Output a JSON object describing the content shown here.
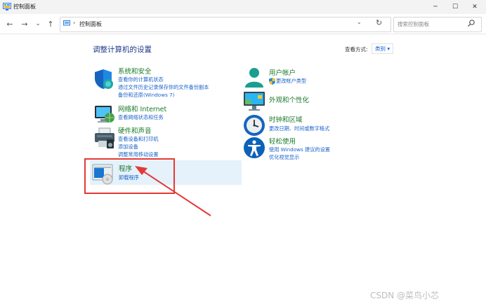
{
  "window": {
    "title": "控制面板"
  },
  "titlebar_buttons": {
    "minimize": "─",
    "maximize": "☐",
    "close": "✕"
  },
  "nav": {
    "back": "←",
    "forward": "→",
    "recent": "⌄",
    "up": "↑"
  },
  "address": {
    "separator": "›",
    "path": "控制面板",
    "dropdown": "⌄",
    "refresh": "↻"
  },
  "search": {
    "placeholder": "搜索控制面板"
  },
  "header": {
    "title": "调整计算机的设置",
    "view_by_label": "查看方式:",
    "view_by_value": "类别 ▾"
  },
  "left_categories": [
    {
      "title": "系统和安全",
      "icon": "shield-icon",
      "links": [
        "查看你的计算机状态",
        "通过文件历史记录保存你的文件备份副本",
        "备份和还原(Windows 7)"
      ]
    },
    {
      "title": "网络和 Internet",
      "icon": "network-globe-icon",
      "links": [
        "查看网络状态和任务"
      ]
    },
    {
      "title": "硬件和声音",
      "icon": "printer-icon",
      "links": [
        "查看设备和打印机",
        "添加设备",
        "调整常用移动设置"
      ]
    },
    {
      "title": "程序",
      "icon": "programs-icon",
      "links": [
        "卸载程序"
      ]
    }
  ],
  "right_categories": [
    {
      "title": "用户帐户",
      "icon": "user-icon",
      "links": [
        "更改帐户类型"
      ]
    },
    {
      "title": "外观和个性化",
      "icon": "monitor-icon",
      "links": []
    },
    {
      "title": "时钟和区域",
      "icon": "clock-globe-icon",
      "links": [
        "更改日期、时间或数字格式"
      ]
    },
    {
      "title": "轻松使用",
      "icon": "accessibility-icon",
      "links": [
        "使用 Windows 建议的设置",
        "优化视觉显示"
      ]
    }
  ],
  "watermark": "CSDN @菜鸟小芯",
  "colors": {
    "highlight": "#e53935",
    "link": "#1a63c9",
    "category_title": "#1a7a2a",
    "hover_bg": "#e5f1fb"
  }
}
